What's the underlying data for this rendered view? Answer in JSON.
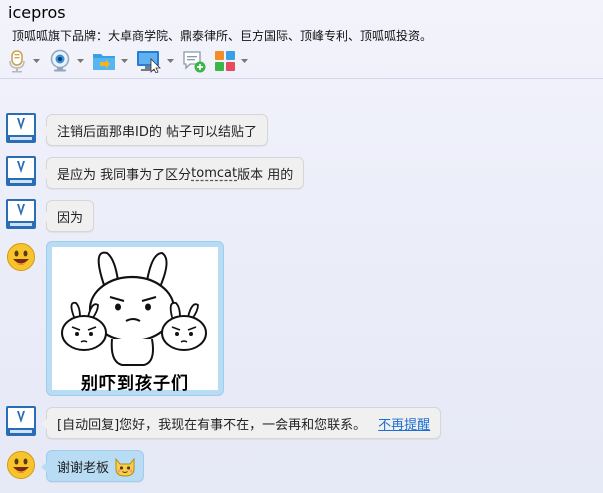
{
  "window": {
    "title": "icepros",
    "subtitle": "顶呱呱旗下品牌：大卓商学院、鼎泰律所、巨方国际、顶峰专利、顶呱呱投资。"
  },
  "toolbar": {
    "tools": [
      {
        "name": "voice-call",
        "icon": "microphone-icon"
      },
      {
        "name": "video-call",
        "icon": "webcam-icon"
      },
      {
        "name": "send-file",
        "icon": "folder-send-icon"
      },
      {
        "name": "remote-desktop",
        "icon": "monitor-icon"
      },
      {
        "name": "create-discussion",
        "icon": "chat-add-icon"
      },
      {
        "name": "apps",
        "icon": "apps-grid-icon"
      }
    ]
  },
  "messages": [
    {
      "sender": "contact",
      "text": "注销后面那串ID的  帖子可以结贴了"
    },
    {
      "sender": "contact",
      "text_before": "是应为  我同事为了区分",
      "text_highlight": "tomcat",
      "text_after": "版本  用的"
    },
    {
      "sender": "contact",
      "text": "因为"
    },
    {
      "sender": "me",
      "type": "sticker",
      "caption": "别吓到孩子们"
    },
    {
      "sender": "contact",
      "text": "[自动回复]您好，我现在有事不在，一会再和您联系。",
      "link": "不再提醒"
    },
    {
      "sender": "me",
      "text": "谢谢老板"
    }
  ],
  "colors": {
    "bubble_contact": "#f0f0f0",
    "bubble_me": "#b7dcf4",
    "link": "#1a6fd1"
  }
}
